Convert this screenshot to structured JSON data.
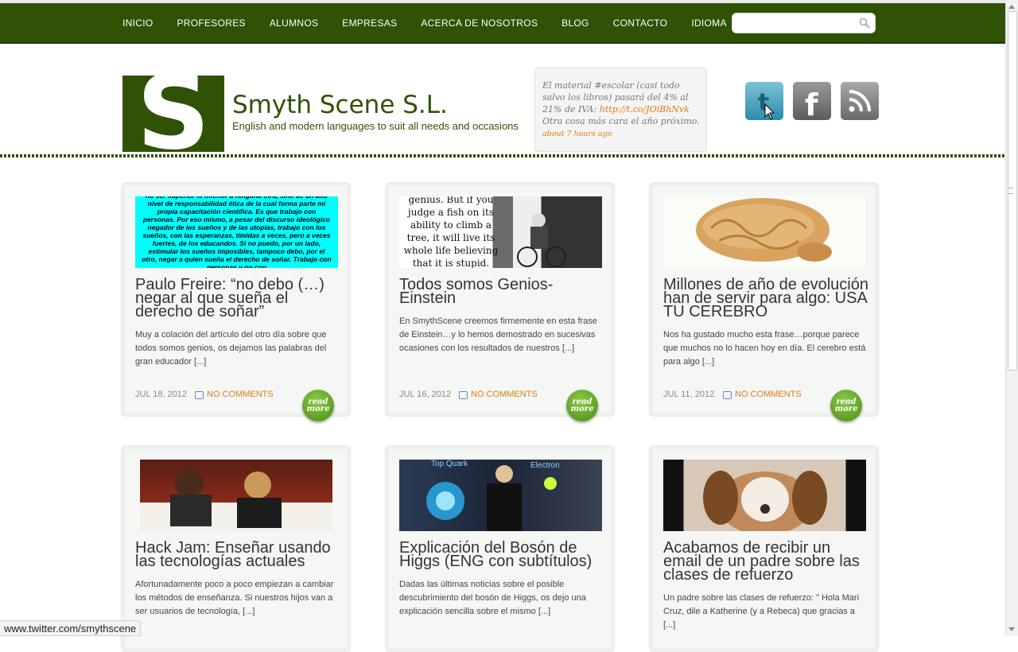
{
  "nav": {
    "items": [
      "INICIO",
      "PROFESORES",
      "ALUMNOS",
      "EMPRESAS",
      "ACERCA DE NOSOTROS",
      "BLOG",
      "CONTACTO",
      "IDIOMA"
    ],
    "search_value": ""
  },
  "header": {
    "logo_letter": "S",
    "title": "Smyth Scene S.L.",
    "tagline": "English and modern languages to suit all needs and occasions"
  },
  "tweet": {
    "text": "El material #escolar (casi todo salvo los libros) pasará del 4% al 21% de IVA: ",
    "link": "http://t.co/JOiBhNvk",
    "text_after": " Otra cosa más cara el año próximo. ",
    "ago": "about 7 hours ago"
  },
  "social": [
    "twitter-icon",
    "facebook-icon",
    "rss-icon"
  ],
  "posts": [
    {
      "title": "Paulo Freire: “no debo (…) negar al que sueña el derecho de soñar”",
      "excerpt": "Muy a colación del artículo del otro día sobre que todos somos genios, os dejamos las palabras del gran educador [...]",
      "date": "JUL 18, 2012",
      "comments": "NO COMMENTS",
      "readmore": "read more",
      "thumb_text": "no ser superior ni inferior a ninguna otra, sino de un alto nivel de responsabilidad ética de la cual forma parte mi propia capacitación científica. Es que trabajo con personas. Por eso mismo, a pesar del discurso ideológico negador de los sueños y de las utopías, trabajo con los sueños, con las esperanzas, tímidas a veces, pero a veces fuertes, de los educandos. Si no puedo, por un lado, estimular los sueños imposibles, tampoco debo, por el otro, negar a quien sueña el derecho de soñar. Trabajo con personas y no con"
    },
    {
      "title": "Todos somos Genios- Einstein",
      "excerpt": "En SmythScene creemos firmemente en esta frase de Einstein…y lo hemos demostrado en sucesivas ocasiones con los resultados de nuestros [...]",
      "date": "JUL 16, 2012",
      "comments": "NO COMMENTS",
      "readmore": "read more",
      "thumb_text": "genius. But if you judge a fish on its ability to climb a tree, it will live its whole life believing that it is stupid."
    },
    {
      "title": "Millones de año de evolución han de servir para algo: USA TU CEREBRO",
      "excerpt": "Nos ha gustado mucho esta frase…porque parece que muchos no lo hacen hoy en día. El cerebro está para algo [...]",
      "date": "JUL 11, 2012",
      "comments": "NO COMMENTS",
      "readmore": "read more"
    },
    {
      "title": "Hack Jam: Enseñar usando las tecnologías actuales",
      "excerpt": "Afortunadamente poco a poco empiezan a cambiar los métodos de enseñanza. Si nuestros hijos van a ser usuarios de tecnología, [...]"
    },
    {
      "title": "Explicación del Bosón de Higgs (ENG con subtítulos)",
      "excerpt": "Dadas las últimas noticias sobre el posible descubrimiento del bosón de Higgs, os dejo una explicación sencilla sobre el mismo [...]",
      "thumb_labels": [
        "Top Quark",
        "Electron"
      ]
    },
    {
      "title": "Acabamos de recibir un email de un padre sobre las clases de refuerzo",
      "excerpt": "Un padre sobre las clases de refuerzo: \" Hola Mari Cruz, dile a Katherine (y a Rebeca) que gracias a [...]"
    }
  ],
  "status_url": "www.twitter.com/smythscene"
}
